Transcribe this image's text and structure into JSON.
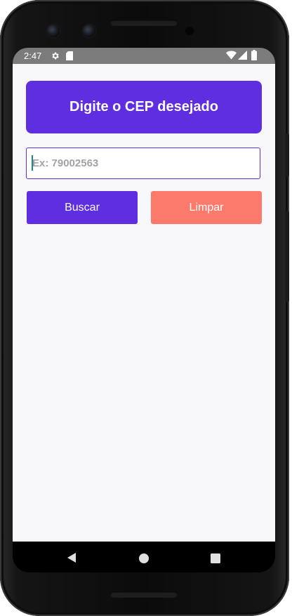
{
  "status_bar": {
    "time": "2:47",
    "icons": [
      "gear-icon",
      "sd-card-icon",
      "wifi-icon",
      "signal-icon",
      "battery-icon"
    ]
  },
  "header": {
    "title": "Digite o CEP desejado"
  },
  "cep_input": {
    "placeholder": "Ex: 79002563",
    "value": ""
  },
  "buttons": {
    "search_label": "Buscar",
    "clear_label": "Limpar"
  },
  "nav_bar": {
    "icons": [
      "back-icon",
      "home-icon",
      "recents-icon"
    ]
  },
  "colors": {
    "primary": "#5e2ee0",
    "clear_button": "#fb7a6c",
    "background": "#f8f8fa",
    "status_bar": "#7b7b7b"
  }
}
